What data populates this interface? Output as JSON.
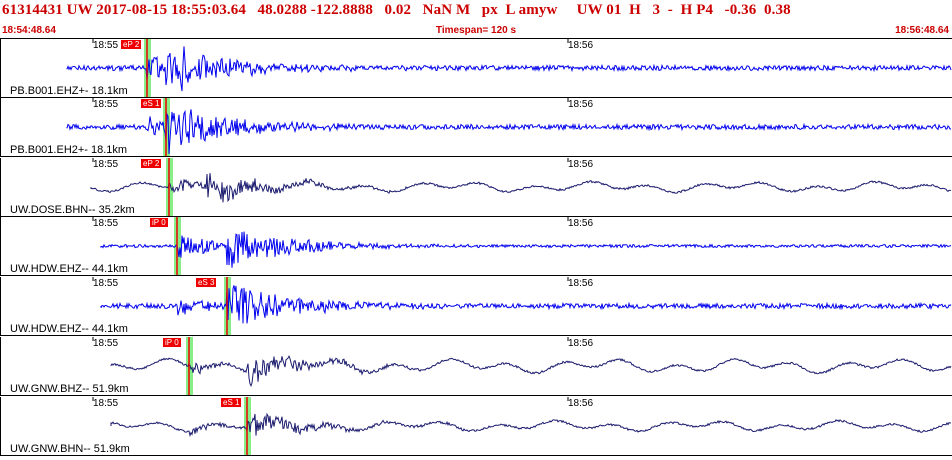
{
  "header": {
    "event_line": "61314431 UW 2017-08-15 18:55:03.64   48.0288 -122.8888   0.02   NaN M   px  L amyw     UW 01  H   3  -  H P4   -0.36  0.38",
    "start_time": "18:54:48.64",
    "timespan": "Timespan= 120 s",
    "end_time": "18:56:48.64"
  },
  "colors": {
    "trace_blue": "#0000ee",
    "trace_navy": "#1a1a6e",
    "pick_red": "#ee0000",
    "pick_band": "#88ee88",
    "header_red": "#cc0000"
  },
  "tick_labels": [
    "18:55",
    "18:56"
  ],
  "panels": [
    {
      "label": "PB.B001.EHZ+-  18.1km",
      "pick": "eP 2",
      "color": "trace_blue"
    },
    {
      "label": "PB.B001.EH2+-  18.1km",
      "pick": "eS 1",
      "color": "trace_blue"
    },
    {
      "label": "UW.DOSE.BHN--  35.2km",
      "pick": "eP 2",
      "color": "trace_navy"
    },
    {
      "label": "UW.HDW.EHZ--  44.1km",
      "pick": "iP 0",
      "color": "trace_blue"
    },
    {
      "label": "UW.HDW.EHZ--  44.1km",
      "pick": "eS 3",
      "color": "trace_blue"
    },
    {
      "label": "UW.GNW.BHZ--  51.9km",
      "pick": "iP 0",
      "color": "trace_navy"
    },
    {
      "label": "UW.GNW.BHN--  51.9km",
      "pick": "eS 1",
      "color": "trace_navy"
    }
  ]
}
